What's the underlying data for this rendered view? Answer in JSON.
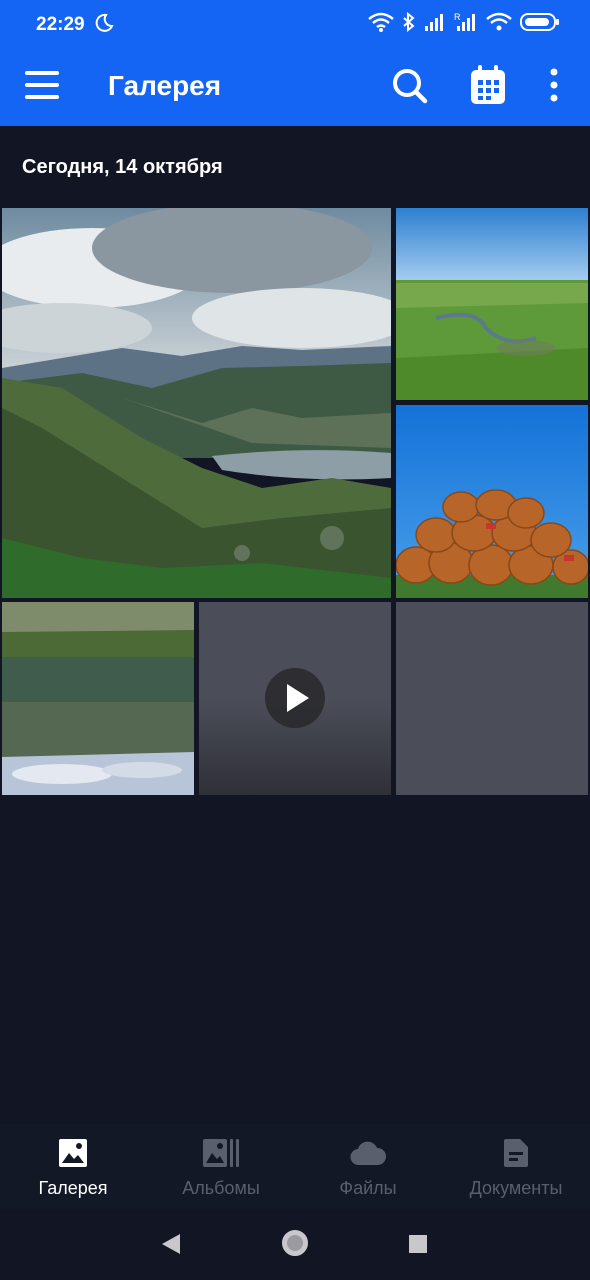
{
  "status_bar": {
    "time": "22:29",
    "icons": [
      "moon-icon",
      "wifi-icon",
      "bluetooth-icon",
      "signal-icon",
      "signal-roaming-icon",
      "wifi-calling-icon",
      "battery-icon"
    ]
  },
  "app_bar": {
    "title": "Галерея",
    "icons": [
      "menu-icon",
      "search-icon",
      "calendar-icon",
      "more-vert-icon"
    ]
  },
  "gallery": {
    "date_header": "Сегодня, 14 октября",
    "items": [
      {
        "type": "photo",
        "subject": "mountain lake landscape"
      },
      {
        "type": "photo",
        "subject": "green steppe with stream"
      },
      {
        "type": "photo",
        "subject": "hay bales under blue sky"
      },
      {
        "type": "photo",
        "subject": "forest lake reflection"
      },
      {
        "type": "video",
        "subject": "video thumbnail"
      },
      {
        "type": "placeholder",
        "subject": "loading thumbnail"
      }
    ]
  },
  "bottom_nav": {
    "items": [
      {
        "label": "Галерея",
        "icon": "gallery-icon",
        "active": true
      },
      {
        "label": "Альбомы",
        "icon": "albums-icon",
        "active": false
      },
      {
        "label": "Файлы",
        "icon": "cloud-icon",
        "active": false
      },
      {
        "label": "Документы",
        "icon": "document-icon",
        "active": false
      }
    ]
  },
  "colors": {
    "accent": "#1565f5",
    "background": "#121624",
    "nav_inactive": "#5a5f6c",
    "placeholder": "#4b4e59"
  }
}
